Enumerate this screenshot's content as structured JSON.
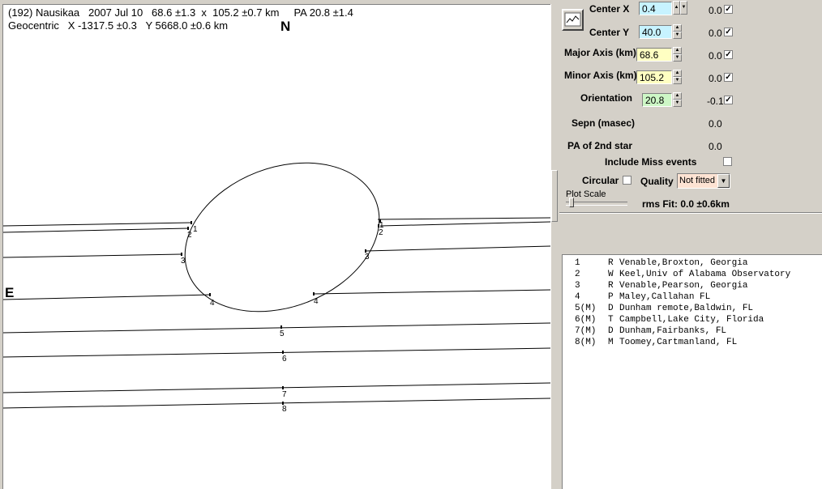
{
  "header": {
    "line1": "(192) Nausikaa   2007 Jul 10   68.6 ±1.3  x  105.2 ±0.7 km     PA 20.8 ±1.4",
    "line2": "Geocentric   X -1317.5 ±0.3   Y 5668.0 ±0.6 km"
  },
  "plot": {
    "north_label": "N",
    "east_label": "E",
    "chord_labels": [
      "1",
      "2",
      "3",
      "4",
      "5",
      "6",
      "7",
      "8"
    ],
    "chord_end_labels": [
      "1",
      "2",
      "3",
      "4"
    ]
  },
  "controls": {
    "center_x": {
      "label": "Center X",
      "value": "0.4",
      "delta": "0.0",
      "checked": true,
      "color": "#c7f3ff"
    },
    "center_y": {
      "label": "Center Y",
      "value": "40.0",
      "delta": "0.0",
      "checked": true,
      "color": "#c7f3ff"
    },
    "major_axis": {
      "label": "Major Axis (km)",
      "value": "68.6",
      "delta": "0.0",
      "checked": true,
      "color": "#ffffc2"
    },
    "minor_axis": {
      "label": "Minor Axis (km)",
      "value": "105.2",
      "delta": "0.0",
      "checked": true,
      "color": "#ffffc2"
    },
    "orientation": {
      "label": "Orientation",
      "value": "20.8",
      "delta": "-0.1",
      "checked": true,
      "color": "#cdf7c6"
    },
    "sepn": {
      "label": "Sepn (masec)",
      "value": "0.0"
    },
    "pa2": {
      "label": "PA of 2nd star",
      "value": "0.0"
    },
    "include_miss": {
      "label": "Include Miss events",
      "checked": false
    },
    "circular": {
      "label": "Circular",
      "checked": false
    },
    "quality": {
      "label": "Quality",
      "value": "Not fitted",
      "color": "#fde3d3"
    },
    "plot_scale": {
      "label": "Plot Scale",
      "level": 0.05
    },
    "rms_fit": "rms Fit: 0.0 ±0.6km",
    "check_glyph": "✓",
    "spin_up": "▲",
    "spin_down": "▼",
    "dropdown_arrow": "▼"
  },
  "observers": [
    {
      "num": "1",
      "type": "R",
      "name": "Venable,Broxton, Georgia"
    },
    {
      "num": "2",
      "type": "W",
      "name": "Keel,Univ of Alabama Observatory"
    },
    {
      "num": "3",
      "type": "R",
      "name": "Venable,Pearson, Georgia"
    },
    {
      "num": "4",
      "type": "P",
      "name": "Maley,Callahan FL"
    },
    {
      "num": "5(M)",
      "type": "D",
      "name": "Dunham remote,Baldwin, FL"
    },
    {
      "num": "6(M)",
      "type": "T",
      "name": "Campbell,Lake City, Florida"
    },
    {
      "num": "7(M)",
      "type": "D",
      "name": "Dunham,Fairbanks, FL"
    },
    {
      "num": "8(M)",
      "type": "M",
      "name": "Toomey,Cartmanland, FL"
    }
  ]
}
